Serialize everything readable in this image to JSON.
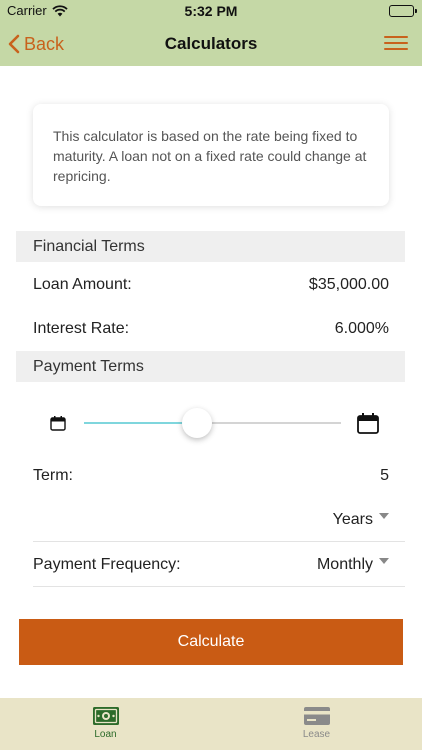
{
  "status_bar": {
    "carrier": "Carrier",
    "time": "5:32 PM"
  },
  "nav": {
    "back_label": "Back",
    "title": "Calculators"
  },
  "info_text": "This calculator is based on the rate being fixed to maturity. A loan not on a fixed rate could change at repricing.",
  "financial_terms": {
    "header": "Financial Terms",
    "loan_amount_label": "Loan Amount:",
    "loan_amount_value": "$35,000.00",
    "interest_rate_label": "Interest Rate:",
    "interest_rate_value": "6.000%"
  },
  "payment_terms": {
    "header": "Payment Terms",
    "slider_fraction": 0.44,
    "term_label": "Term:",
    "term_value": "5",
    "term_unit_selected": "Years",
    "frequency_label": "Payment Frequency:",
    "frequency_selected": "Monthly"
  },
  "calculate_label": "Calculate",
  "tabs": [
    {
      "label": "Loan",
      "icon": "money-icon",
      "active": true
    },
    {
      "label": "Lease",
      "icon": "credit-card-icon",
      "active": false
    }
  ],
  "colors": {
    "header_green": "#c5d8a6",
    "accent_orange": "#c8621c",
    "button_orange": "#c95b14",
    "tab_bar": "#e9e4c7",
    "slider_fill": "#7fd6dd",
    "active_tab": "#2d6b2a"
  }
}
